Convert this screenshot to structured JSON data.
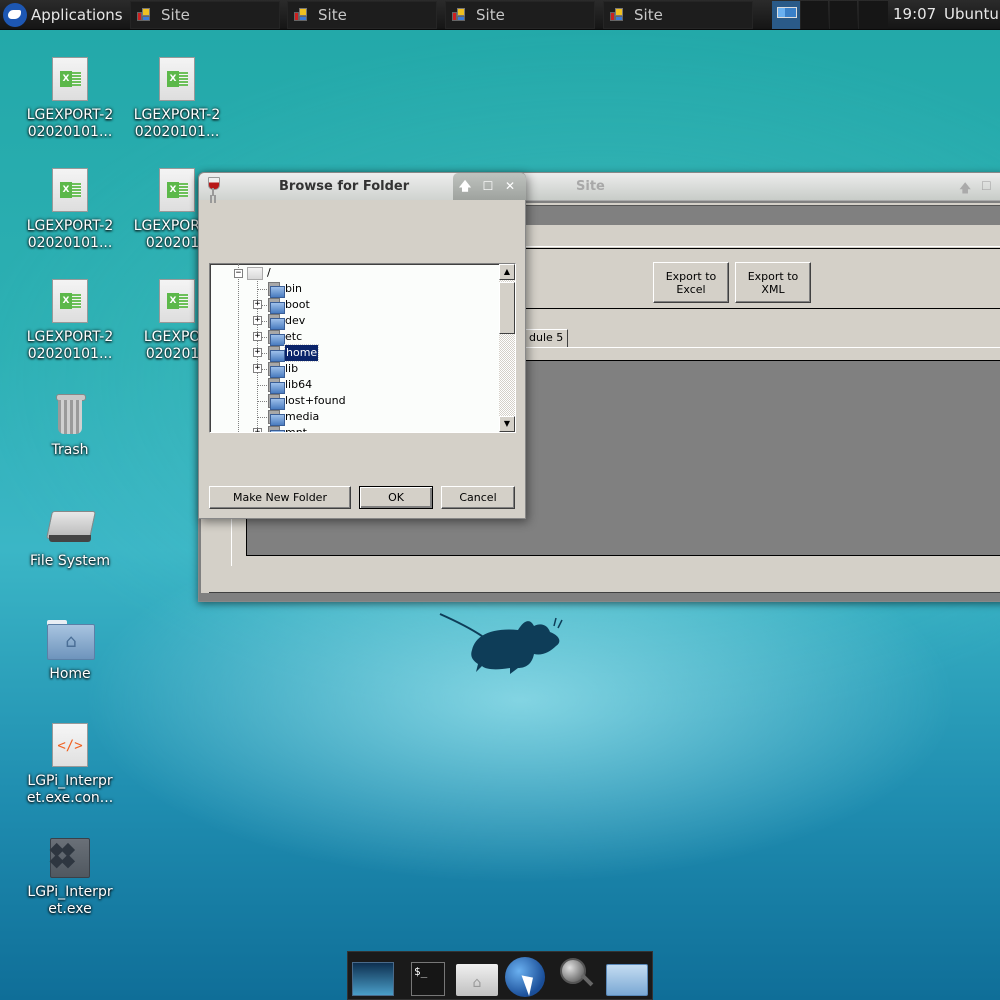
{
  "top_panel": {
    "applications_label": "Applications",
    "tasks": [
      {
        "label": "Site"
      },
      {
        "label": "Site"
      },
      {
        "label": "Site"
      },
      {
        "label": "Site"
      }
    ],
    "clock": "19:07",
    "user": "Ubuntu"
  },
  "desktop_icons": [
    {
      "label": "LGEXPORT-2\n02020101...",
      "type": "spreadsheet"
    },
    {
      "label": "LGEXPORT-2\n02020101...",
      "type": "spreadsheet"
    },
    {
      "label": "LGEXPORT-2\n02020101...",
      "type": "spreadsheet"
    },
    {
      "label": "LGEXPORT-2\n0202010",
      "type": "spreadsheet"
    },
    {
      "label": "LGEXPORT-2\n02020101...",
      "type": "spreadsheet"
    },
    {
      "label": "LGEXPOR\n0202010",
      "type": "spreadsheet"
    },
    {
      "label": "Trash",
      "type": "trash"
    },
    {
      "label": "File System",
      "type": "drive"
    },
    {
      "label": "Home",
      "type": "home-folder"
    },
    {
      "label": "LGPi_Interpr\net.exe.con...",
      "type": "config-file"
    },
    {
      "label": "LGPi_Interpr\net.exe",
      "type": "executable"
    }
  ],
  "site_window": {
    "title": "Site",
    "export_excel_label": "Export to\nExcel",
    "export_xml_label": "Export to XML",
    "tab_label": "dule 5"
  },
  "browse_dialog": {
    "title": "Browse for Folder",
    "tree": {
      "root": "/",
      "items": [
        {
          "label": "bin",
          "expandable": false
        },
        {
          "label": "boot",
          "expandable": true
        },
        {
          "label": "dev",
          "expandable": true
        },
        {
          "label": "etc",
          "expandable": true
        },
        {
          "label": "home",
          "expandable": true,
          "selected": true
        },
        {
          "label": "lib",
          "expandable": true
        },
        {
          "label": "lib64",
          "expandable": false
        },
        {
          "label": "lost+found",
          "expandable": false
        },
        {
          "label": "media",
          "expandable": false
        },
        {
          "label": "mnt",
          "expandable": true
        }
      ]
    },
    "buttons": {
      "make_new_folder": "Make New Folder",
      "ok": "OK",
      "cancel": "Cancel"
    }
  },
  "dock": {
    "items": [
      "show-desktop",
      "terminal",
      "home-folder",
      "web-browser",
      "app-finder",
      "file-manager"
    ]
  }
}
